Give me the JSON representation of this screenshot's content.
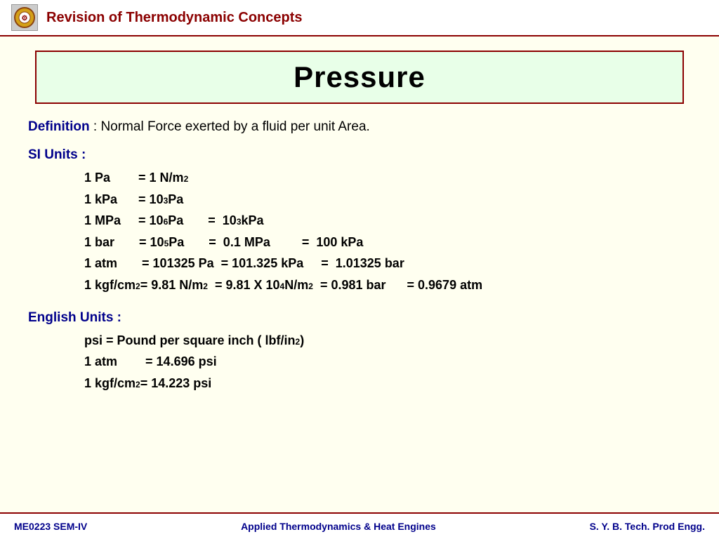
{
  "header": {
    "title": "Revision of Thermodynamic Concepts"
  },
  "page": {
    "title": "Pressure"
  },
  "definition": {
    "label": "Definition",
    "text": " : Normal Force exerted by a fluid per unit Area."
  },
  "si_units": {
    "label": "SI Units",
    "colon": " :",
    "rows": [
      {
        "content": "1 Pa&nbsp;&nbsp;&nbsp;&nbsp;&nbsp;&nbsp; = 1 N/m<sup>2</sup>"
      },
      {
        "content": "1 kPa&nbsp;&nbsp;&nbsp;&nbsp; = 10<sup>3</sup> Pa"
      },
      {
        "content": "1 MPa&nbsp;&nbsp;&nbsp; = 10<sup>6</sup> Pa&nbsp;&nbsp;&nbsp;&nbsp; =&nbsp; 10<sup>3</sup> kPa"
      },
      {
        "content": "1 bar&nbsp;&nbsp;&nbsp;&nbsp;&nbsp; = 10<sup>5</sup> Pa&nbsp;&nbsp;&nbsp;&nbsp; =&nbsp; 0.1 MPa&nbsp;&nbsp;&nbsp;&nbsp;&nbsp;&nbsp; =&nbsp; 100 kPa"
      },
      {
        "content": "1 atm&nbsp;&nbsp;&nbsp;&nbsp;&nbsp; = 101325 Pa&nbsp; = 101.325 kPa&nbsp;&nbsp;&nbsp;&nbsp; =&nbsp; 1.01325 bar"
      },
      {
        "content": "1 kgf/cm<sup>2</sup> = 9.81 N/m<sup>2</sup>&nbsp; = 9.81 X 10<sup>4</sup> N/m<sup>2</sup>&nbsp; = 0.981 bar&nbsp;&nbsp;&nbsp;&nbsp;&nbsp; = 0.9679 atm"
      }
    ]
  },
  "english_units": {
    "label": "English Units",
    "colon": " :",
    "rows": [
      {
        "content": "psi = Pound per square inch ( lbf/in<sup>2</sup>)"
      },
      {
        "content": "1 atm&nbsp;&nbsp;&nbsp;&nbsp;&nbsp;&nbsp; = 14.696 psi"
      },
      {
        "content": "1 kgf/cm<sup>2</sup> = 14.223 psi"
      }
    ]
  },
  "footer": {
    "left": "ME0223 SEM-IV",
    "center": "Applied Thermodynamics & Heat Engines",
    "right": "S. Y. B. Tech. Prod Engg."
  }
}
